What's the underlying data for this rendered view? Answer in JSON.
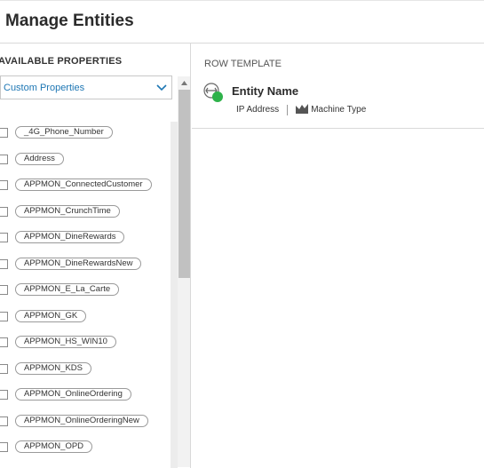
{
  "header": {
    "title": "Manage Entities"
  },
  "left_panel": {
    "heading": "AVAILABLE PROPERTIES",
    "dropdown": {
      "selected": "Custom Properties"
    },
    "properties": [
      "_4G_Phone_Number",
      "Address",
      "APPMON_ConnectedCustomer",
      "APPMON_CrunchTime",
      "APPMON_DineRewards",
      "APPMON_DineRewardsNew",
      "APPMON_E_La_Carte",
      "APPMON_GK",
      "APPMON_HS_WIN10",
      "APPMON_KDS",
      "APPMON_OnlineOrdering",
      "APPMON_OnlineOrderingNew",
      "APPMON_OPD"
    ]
  },
  "right_panel": {
    "label": "ROW TEMPLATE",
    "entity_name": "Entity Name",
    "ip_address": "IP Address",
    "machine_type": "Machine Type"
  },
  "colors": {
    "accent": "#1e77b4",
    "status_green": "#2eb24a"
  }
}
